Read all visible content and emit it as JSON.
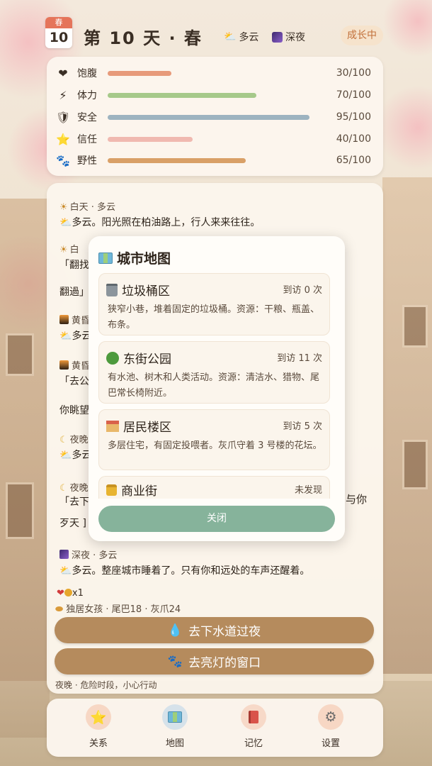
{
  "header": {
    "season_badge": "春",
    "day_badge": "10",
    "title": "第 10 天 · 春",
    "weather": "多云",
    "time_of_day": "深夜",
    "growth_status": "成长中"
  },
  "stats": [
    {
      "icon": "heart-icon",
      "glyph": "❤",
      "label": "饱腹",
      "value": 30,
      "display": "30/100",
      "color": "#e79a7a"
    },
    {
      "icon": "lightning-icon",
      "glyph": "⚡",
      "label": "体力",
      "value": 70,
      "display": "70/100",
      "color": "#a6c98a"
    },
    {
      "icon": "shield-icon",
      "glyph": "🛡",
      "label": "安全",
      "value": 95,
      "display": "95/100",
      "color": "#9db3c0"
    },
    {
      "icon": "star-icon",
      "glyph": "⭐",
      "label": "信任",
      "value": 40,
      "display": "40/100",
      "color": "#f0b9b0"
    },
    {
      "icon": "paw-icon",
      "glyph": "🐾",
      "label": "野性",
      "value": 65,
      "display": "65/100",
      "color": "#d9a067"
    }
  ],
  "log": {
    "day_header": "白天 · 多云",
    "day_text": "多云。阳光照在柏油路上，行人来来往往。",
    "partial_1": "白",
    "partial_2": "「翻找",
    "partial_3": "翻過」",
    "partial_4": "黄昏",
    "partial_5": "多云",
    "partial_6": "黄昏",
    "partial_7": "「去公",
    "partial_8": "你眺望",
    "partial_9": "夜晚",
    "partial_10": "多云",
    "partial_11": "夜晚",
    "partial_12": "「去下",
    "partial_13": "与你",
    "partial_14": "歹天 ]",
    "night_header": "深夜 · 多云",
    "night_text": "多云。整座城市睡着了。只有你和远处的车声还醒着。"
  },
  "inventory": {
    "items": "x1",
    "companions": "独居女孩 · 尾巴18 · 灰爪24"
  },
  "actions": {
    "sewer": "去下水道过夜",
    "window": "去亮灯的窗口",
    "danger_note": "夜晚 · 危险时段，小心行动"
  },
  "nav": [
    {
      "label": "关系",
      "icon": "star-icon"
    },
    {
      "label": "地图",
      "icon": "map-icon"
    },
    {
      "label": "记忆",
      "icon": "book-icon"
    },
    {
      "label": "设置",
      "icon": "gear-icon"
    }
  ],
  "map_modal": {
    "title": "城市地图",
    "locations": [
      {
        "name": "垃圾桶区",
        "visits": "到访 0 次",
        "desc": "狭窄小巷，堆着固定的垃圾桶。资源：干粮、瓶盖、布条。"
      },
      {
        "name": "东街公园",
        "visits": "到访 11 次",
        "desc": "有水池、树木和人类活动。资源：清洁水、猎物、尾巴常长椅附近。"
      },
      {
        "name": "居民楼区",
        "visits": "到访 5 次",
        "desc": "多层住宅，有固定投喂者。灰爪守着 3 号楼的花坛。"
      },
      {
        "name": "商业街",
        "visits": "未发现",
        "desc": ""
      }
    ],
    "close_label": "关闭"
  }
}
